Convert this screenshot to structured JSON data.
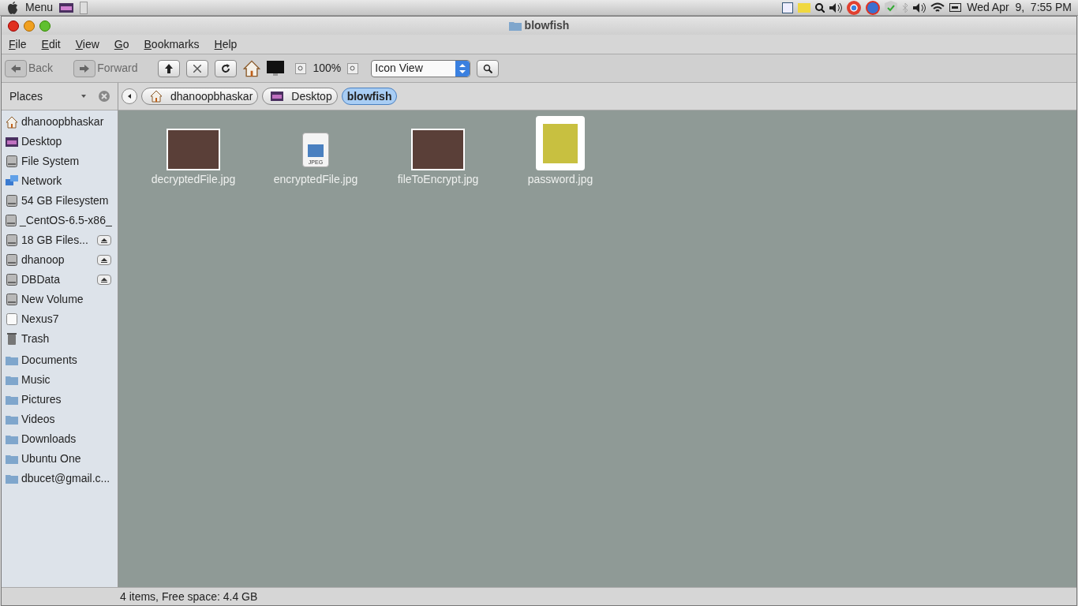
{
  "top_panel": {
    "menu": "Menu",
    "clock": "Wed Apr  9,  7:55 PM"
  },
  "window": {
    "title": "blowfish"
  },
  "menubar": [
    "File",
    "Edit",
    "View",
    "Go",
    "Bookmarks",
    "Help"
  ],
  "toolbar": {
    "back": {
      "label": "Back",
      "disabled": true
    },
    "forward": {
      "label": "Forward",
      "disabled": true
    },
    "zoom": "100%",
    "view": "Icon View"
  },
  "sidebar": {
    "title": "Places",
    "items": [
      {
        "label": "dhanoopbhaskar",
        "kind": "home",
        "eject": false
      },
      {
        "label": "Desktop",
        "kind": "desktop",
        "eject": false
      },
      {
        "label": "File System",
        "kind": "drive",
        "eject": false
      },
      {
        "label": "Network",
        "kind": "network",
        "eject": false
      },
      {
        "label": "54 GB Filesystem",
        "kind": "drive",
        "eject": false
      },
      {
        "label": "_CentOS-6.5-x86_",
        "kind": "drive",
        "eject": false
      },
      {
        "label": "18 GB Files...",
        "kind": "drive",
        "eject": true
      },
      {
        "label": "dhanoop",
        "kind": "drive",
        "eject": true
      },
      {
        "label": "DBData",
        "kind": "drive",
        "eject": true
      },
      {
        "label": "New Volume",
        "kind": "drive",
        "eject": false
      },
      {
        "label": "Nexus7",
        "kind": "device",
        "eject": false
      },
      {
        "label": "Trash",
        "kind": "trash",
        "eject": false
      }
    ],
    "bookmarks": [
      "Documents",
      "Music",
      "Pictures",
      "Videos",
      "Downloads",
      "Ubuntu One",
      "dbucet@gmail.c..."
    ]
  },
  "pathbar": [
    {
      "label": "dhanoopbhaskar",
      "kind": "home",
      "selected": false
    },
    {
      "label": "Desktop",
      "kind": "desktop",
      "selected": false
    },
    {
      "label": "blowfish",
      "kind": "folder",
      "selected": true
    }
  ],
  "files": [
    {
      "name": "decryptedFile.jpg",
      "kind": "photo"
    },
    {
      "name": "encryptedFile.jpg",
      "kind": "document",
      "badge": "JPEG"
    },
    {
      "name": "fileToEncrypt.jpg",
      "kind": "photo"
    },
    {
      "name": "password.jpg",
      "kind": "picture"
    }
  ],
  "status_bar": "4 items, Free space: 4.4 GB"
}
